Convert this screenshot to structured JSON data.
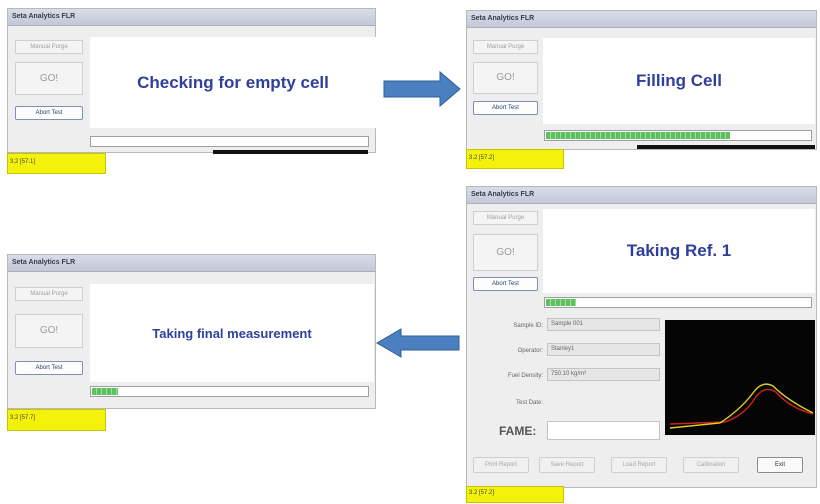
{
  "app": {
    "title": "Seta Analytics FLR"
  },
  "buttons": {
    "manual_purge": "Manual Purge",
    "go": "GO!",
    "abort": "Abort Test"
  },
  "windows": [
    {
      "message": "Checking for empty cell",
      "status": "3.2 [57.1]",
      "progress": 0.0
    },
    {
      "message": "Filling Cell",
      "status": "3.2 [57.2]",
      "progress": 0.7
    },
    {
      "message": "Taking Ref. 1",
      "status": "3.2 [57.2]",
      "progress": 0.12
    },
    {
      "message": "Taking final measurement",
      "status": "3.2 [57.7]",
      "progress": 0.1
    }
  ],
  "form": {
    "sample_id": {
      "label": "Sample ID:",
      "value": "Sample 001"
    },
    "operator": {
      "label": "Operator:",
      "value": "Stanley1"
    },
    "fuel_density": {
      "label": "Fuel Density:",
      "value": "750.10 kg/m³"
    },
    "test_date": {
      "label": "Test Date:",
      "value": ""
    },
    "fame": {
      "label": "FAME:",
      "value": ""
    }
  },
  "bottom_buttons": {
    "print_report": "Print Report",
    "save_report": "Save Report",
    "load_report": "Load Report",
    "calibration": "Calibration",
    "exit": "Exit"
  },
  "colors": {
    "message_text": "#2f3f9c",
    "status_bg": "#f4f20a",
    "progress_fill": "#5ec15e",
    "arrow": "#4a7fc0",
    "graph_bg": "#050505",
    "curve_yellow": "#e0d020",
    "curve_red": "#d02020"
  }
}
